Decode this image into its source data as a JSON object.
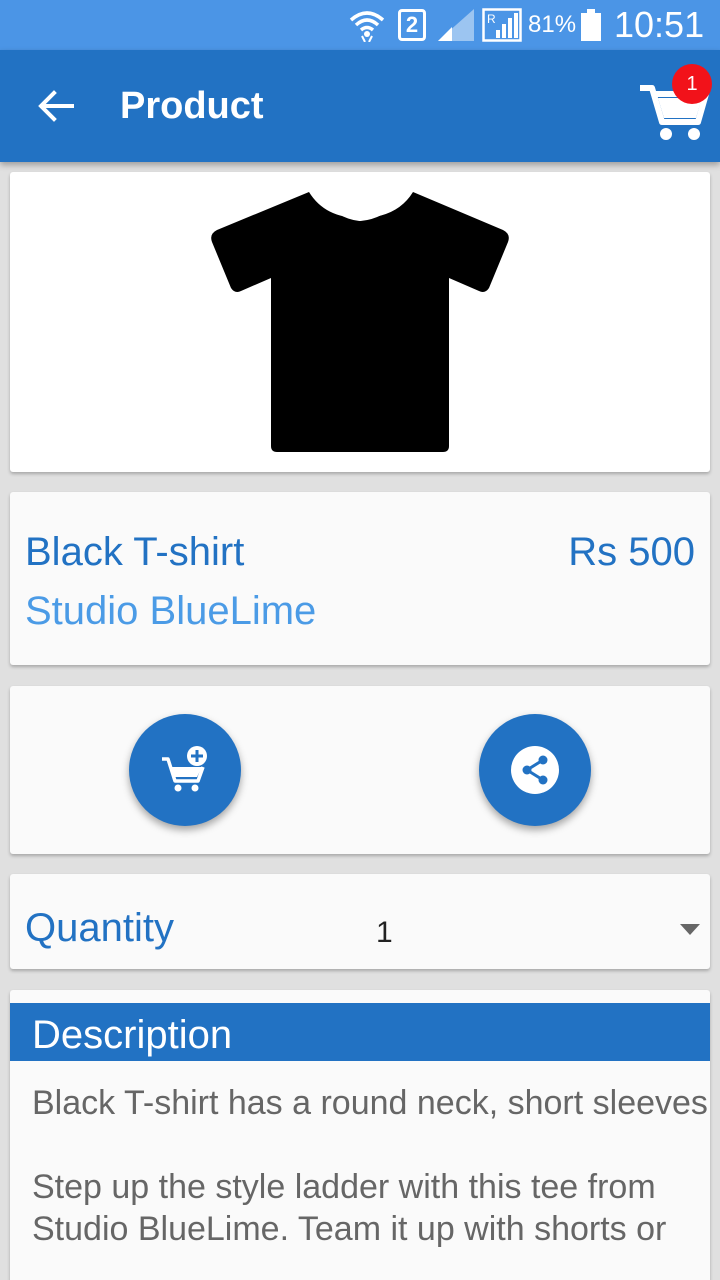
{
  "status_bar": {
    "battery_percent": "81%",
    "time": "10:51",
    "sim_slot": "2",
    "icons": [
      "wifi-icon",
      "sim-2-icon",
      "signal-icon",
      "roaming-signal-icon",
      "battery-icon"
    ]
  },
  "app_bar": {
    "title": "Product",
    "cart_count": "1",
    "icons": [
      "back-arrow-icon",
      "shopping-cart-icon"
    ]
  },
  "product": {
    "image_icon": "tshirt-image",
    "name": "Black T-shirt",
    "price": "Rs 500",
    "brand": "Studio BlueLime"
  },
  "actions": {
    "icons": [
      "add-to-cart-icon",
      "share-icon"
    ]
  },
  "quantity": {
    "label": "Quantity",
    "selected": "1",
    "icon": "dropdown-arrow-icon"
  },
  "description": {
    "title": "Description",
    "text": "Black T-shirt has a round neck, short sleeves.\n\nStep up the style ladder with this tee from Studio BlueLime. Team it up with shorts or"
  },
  "colors": {
    "primary": "#2272c3",
    "status_bar": "#4b95e6",
    "brand_text": "#4b9be6",
    "badge": "#f2121a",
    "card_background": "#fafafa",
    "page_background": "#e0e0e0"
  }
}
